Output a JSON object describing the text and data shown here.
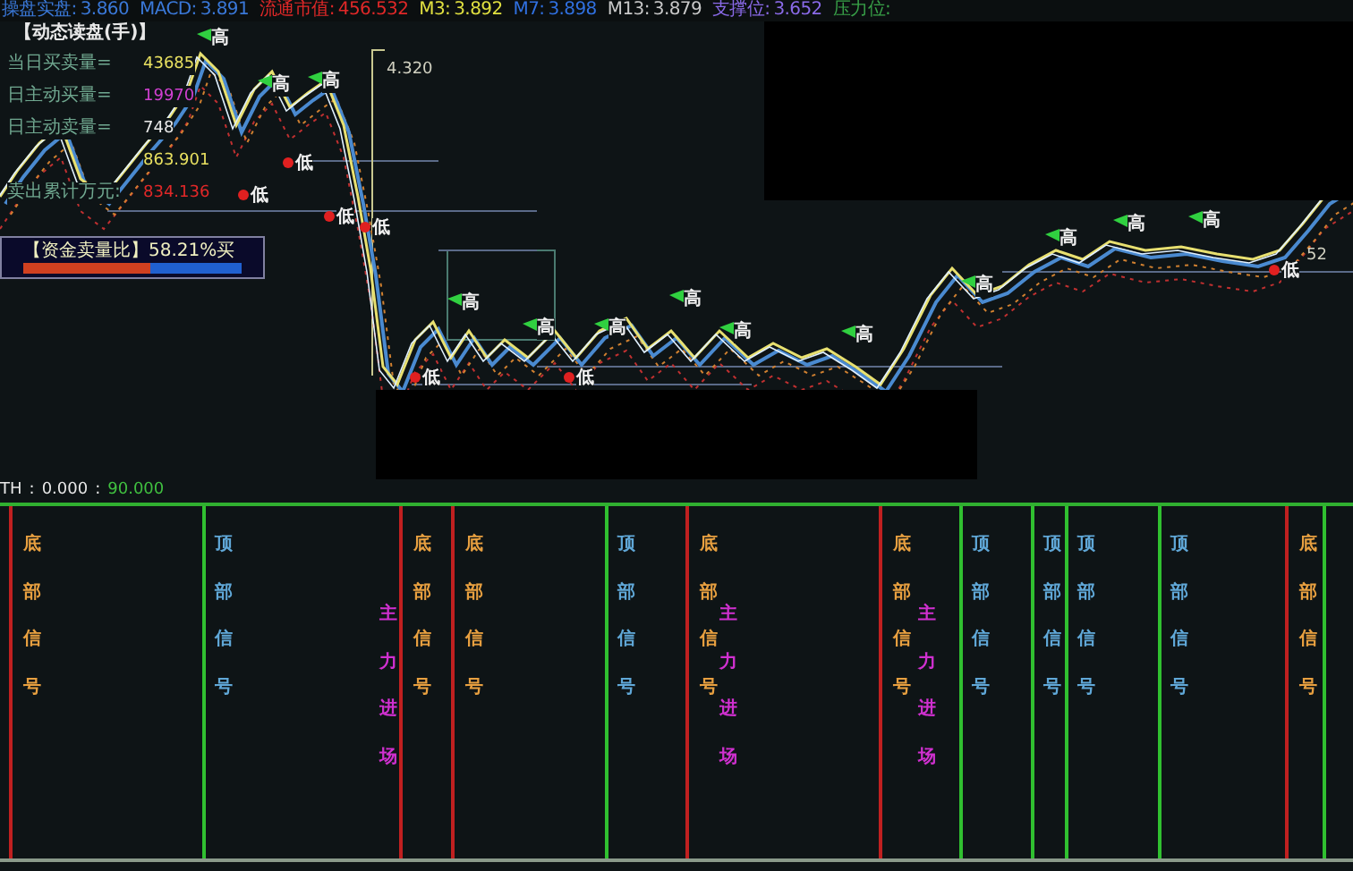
{
  "header": [
    {
      "label": "操盘实盘:",
      "value": "3.860",
      "color": "#3a78d8"
    },
    {
      "label": "MACD:",
      "value": "3.891",
      "color": "#3a78d8"
    },
    {
      "label": "流通市值:",
      "value": "456.532",
      "color": "#e02828"
    },
    {
      "label": "M3:",
      "value": "3.892",
      "color": "#e0e040"
    },
    {
      "label": "M7:",
      "value": "3.898",
      "color": "#3070e0"
    },
    {
      "label": "M13:",
      "value": "3.879",
      "color": "#c8c8c8"
    },
    {
      "label": "支撑位:",
      "value": "3.652",
      "color": "#8a6ae8"
    },
    {
      "label": "压力位:",
      "color": "#38a048"
    }
  ],
  "readout": {
    "title": "【动态读盘(手)】",
    "rows": [
      {
        "label": "当日买卖量=",
        "value": "43685",
        "color": "#e8e060"
      },
      {
        "label": "日主动买量=",
        "value": "19970",
        "color": "#d040d0"
      },
      {
        "label": "日主动卖量=",
        "value": "748",
        "color": "#e8e8e8"
      },
      {
        "value": "863.901",
        "color": "#e8e060"
      },
      {
        "label": "卖出累计万元:",
        "value": "834.136",
        "color": "#e02828"
      }
    ]
  },
  "fund_ratio": {
    "label": "【资金卖量比】58.21%买",
    "level": 0.58
  },
  "price_labels": [
    {
      "text": "4.320"
    },
    {
      "text": "52"
    }
  ],
  "markers": [
    {
      "kind": "high",
      "text": "高"
    },
    {
      "kind": "high",
      "text": "高"
    },
    {
      "kind": "high",
      "text": "高"
    },
    {
      "kind": "low",
      "text": "低"
    },
    {
      "kind": "low",
      "text": "低"
    },
    {
      "kind": "high",
      "text": "高"
    },
    {
      "kind": "high",
      "text": "高"
    },
    {
      "kind": "low",
      "text": "低"
    },
    {
      "kind": "low",
      "text": "低"
    },
    {
      "kind": "high",
      "text": "高"
    },
    {
      "kind": "low",
      "text": "低"
    },
    {
      "kind": "high",
      "text": "高"
    },
    {
      "kind": "low",
      "text": "低"
    },
    {
      "kind": "high",
      "text": "高"
    },
    {
      "kind": "high",
      "text": "高"
    },
    {
      "kind": "high",
      "text": "高"
    },
    {
      "kind": "high",
      "text": "高"
    },
    {
      "kind": "low",
      "text": "低"
    },
    {
      "kind": "high",
      "text": "高"
    },
    {
      "kind": "high",
      "text": "高"
    }
  ],
  "indicator": {
    "title": [
      {
        "kind": "name",
        "text": "TH"
      },
      {
        "kind": "sep",
        "text": ":"
      },
      {
        "kind": "value",
        "text": "0.000"
      },
      {
        "kind": "sep",
        "text": ":"
      },
      {
        "kind": "limit",
        "text": "90.000"
      }
    ],
    "signals": [
      {
        "kind": "bottom",
        "text": "底部信号"
      },
      {
        "kind": "top",
        "text": "顶部信号"
      },
      {
        "kind": "main",
        "text": "主力进场"
      },
      {
        "kind": "bottom",
        "text": "底部信号"
      },
      {
        "kind": "bottom",
        "text": "底部信号"
      },
      {
        "kind": "top",
        "text": "顶部信号"
      },
      {
        "kind": "bottom",
        "text": "底部信号"
      },
      {
        "kind": "main",
        "text": "主力进场"
      },
      {
        "kind": "bottom",
        "text": "底部信号"
      },
      {
        "kind": "main",
        "text": "主力进场"
      },
      {
        "kind": "top",
        "text": "顶部信号"
      },
      {
        "kind": "top",
        "text": "顶部信号"
      },
      {
        "kind": "top",
        "text": "顶部信号"
      },
      {
        "kind": "top",
        "text": "顶部信号"
      },
      {
        "kind": "bottom",
        "text": "底部信号"
      },
      {
        "kind": "top"
      }
    ]
  }
}
